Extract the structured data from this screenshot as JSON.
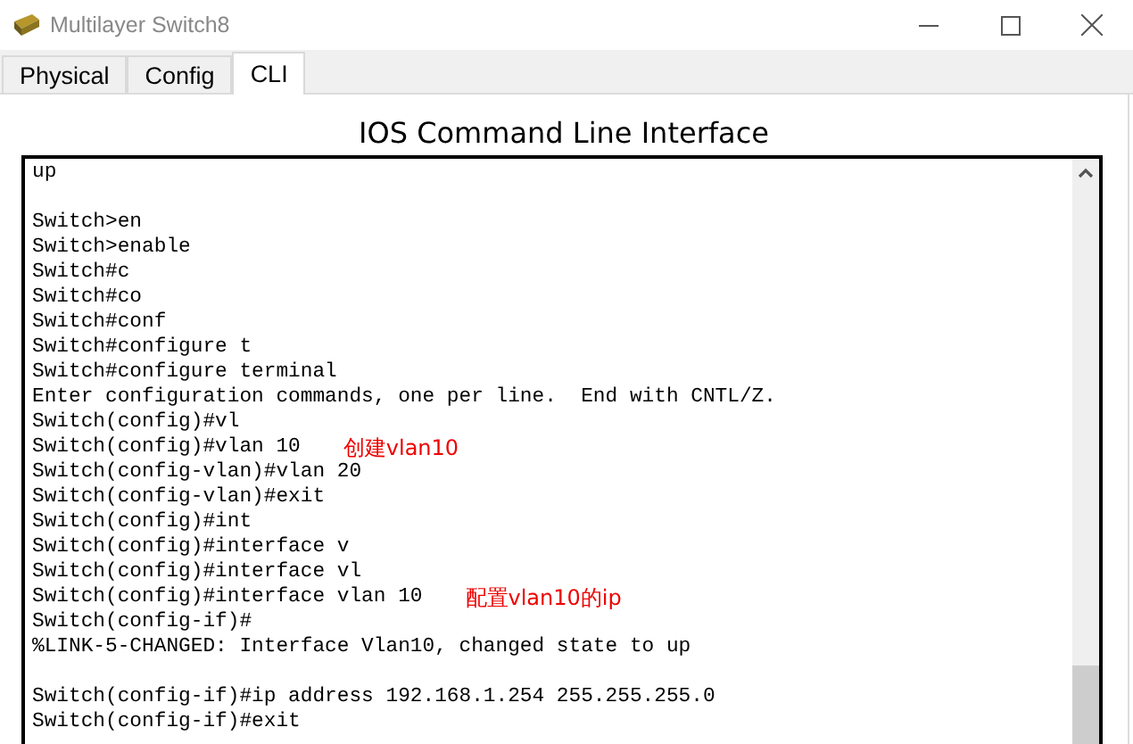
{
  "window": {
    "title": "Multilayer Switch8"
  },
  "tabs": [
    {
      "label": "Physical",
      "selected": false
    },
    {
      "label": "Config",
      "selected": false
    },
    {
      "label": "CLI",
      "selected": true
    }
  ],
  "heading": "IOS Command Line Interface",
  "terminal": {
    "blocks": [
      {
        "lines": [
          {
            "text": "up"
          }
        ]
      },
      {
        "lines": [
          {
            "text": "Switch>en"
          },
          {
            "text": "Switch>enable"
          },
          {
            "text": "Switch#c"
          },
          {
            "text": "Switch#co"
          },
          {
            "text": "Switch#conf"
          },
          {
            "text": "Switch#configure t"
          },
          {
            "text": "Switch#configure terminal"
          },
          {
            "text": "Enter configuration commands, one per line.  End with CNTL/Z."
          },
          {
            "text": "Switch(config)#vl"
          },
          {
            "text": "Switch(config)#vlan 10",
            "note": "创建vlan10"
          },
          {
            "text": "Switch(config-vlan)#vlan 20"
          },
          {
            "text": "Switch(config-vlan)#exit"
          },
          {
            "text": "Switch(config)#int"
          },
          {
            "text": "Switch(config)#interface v"
          },
          {
            "text": "Switch(config)#interface vl"
          },
          {
            "text": "Switch(config)#interface vlan 10",
            "note": "配置vlan10的ip"
          },
          {
            "text": "Switch(config-if)#"
          },
          {
            "text": "%LINK-5-CHANGED: Interface Vlan10, changed state to up"
          }
        ]
      },
      {
        "lines": [
          {
            "text": "Switch(config-if)#ip address 192.168.1.254 255.255.255.0"
          },
          {
            "text": "Switch(config-if)#exit"
          }
        ]
      }
    ]
  }
}
